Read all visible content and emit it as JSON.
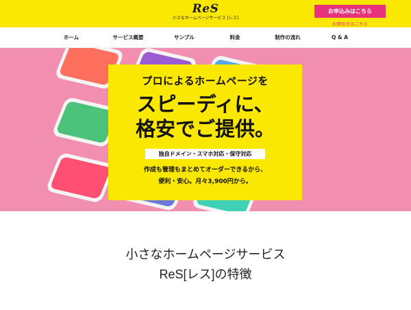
{
  "header": {
    "logo": "ReS",
    "tagline": "小さなホームページサービス [レス]",
    "apply_label": "お申込みはこちら",
    "contact_label": "お問合せはこちら",
    "background_color": "#fbe800",
    "accent_color": "#e8337a"
  },
  "nav": {
    "items": [
      {
        "label": "ホーム"
      },
      {
        "label": "サービス概要"
      },
      {
        "label": "サンプル"
      },
      {
        "label": "料金"
      },
      {
        "label": "制作の流れ"
      },
      {
        "label": "Q & A"
      }
    ]
  },
  "hero": {
    "background_color": "#f28fb0",
    "headline_small": "プロによるホームページを",
    "headline_line1": "スピーディに、",
    "headline_line2": "格安でご提供。",
    "features": "独自ドメイン・スマホ対応・保守対応",
    "description_line1": "作成も管理もまとめてオーダーできるから、",
    "description_line2": "便利・安心。月々3,900円から。"
  },
  "section": {
    "title_line1": "小さなホームページサービス",
    "title_line2": "ReS[レス]の特徴"
  }
}
